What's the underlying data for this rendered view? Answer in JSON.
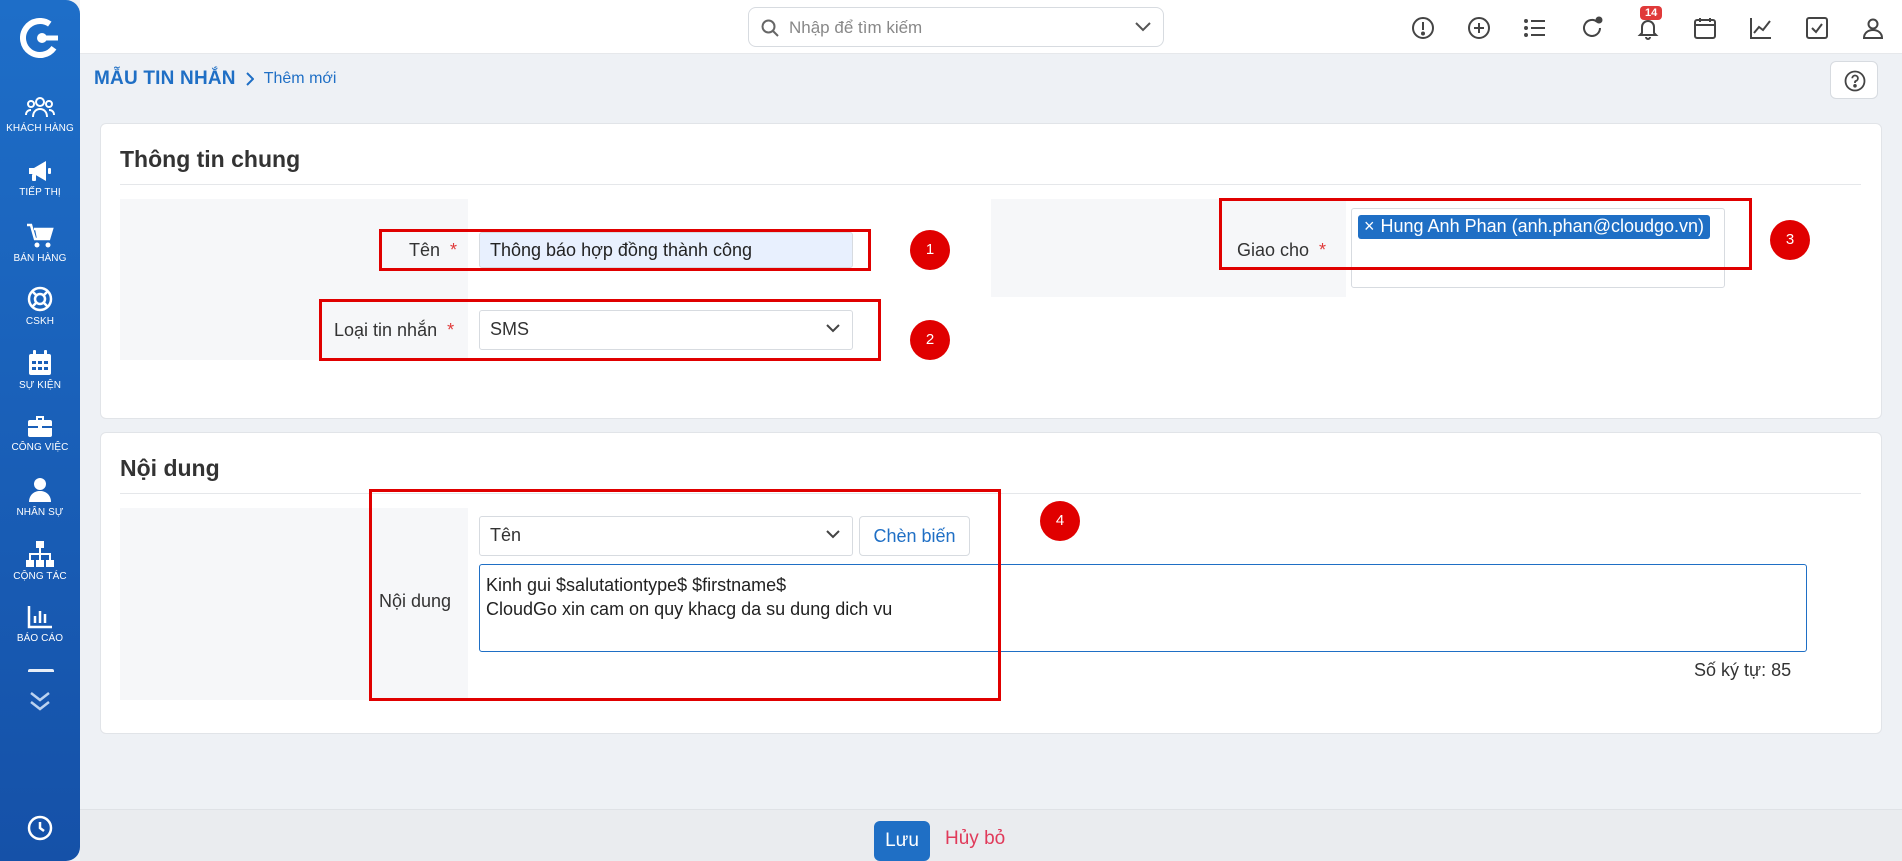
{
  "header": {
    "search": {
      "placeholder": "Nhập để tìm kiếm"
    },
    "notifications": {
      "badge_count": "14"
    },
    "icons": [
      "alert-icon",
      "plus-circle-icon",
      "list-icon",
      "refresh-icon",
      "bell-icon",
      "calendar-icon",
      "chart-icon",
      "checkbox-icon",
      "user-icon"
    ]
  },
  "sidebar": {
    "items": [
      {
        "label": "KHÁCH HÀNG",
        "icon": "users-icon"
      },
      {
        "label": "TIẾP THỊ",
        "icon": "megaphone-icon"
      },
      {
        "label": "BÁN HÀNG",
        "icon": "cart-icon"
      },
      {
        "label": "CSKH",
        "icon": "lifebuoy-icon"
      },
      {
        "label": "SỰ KIỆN",
        "icon": "calendar-icon"
      },
      {
        "label": "CÔNG VIỆC",
        "icon": "briefcase-icon"
      },
      {
        "label": "NHÂN SỰ",
        "icon": "person-icon"
      },
      {
        "label": "CỘNG TÁC",
        "icon": "org-chart-icon"
      },
      {
        "label": "BÁO CÁO",
        "icon": "bar-chart-icon"
      }
    ]
  },
  "breadcrumb": {
    "root": "MẪU TIN NHẮN",
    "current": "Thêm mới"
  },
  "section_general": {
    "title": "Thông tin chung",
    "name_label": "Tên",
    "name_value": "Thông báo hợp đồng thành công",
    "type_label": "Loại tin nhắn",
    "type_value": "SMS",
    "assign_label": "Giao cho",
    "assign_tag": "Hung Anh Phan (anh.phan@cloudgo.vn)",
    "required_mark": "*"
  },
  "section_content": {
    "title": "Nội dung",
    "content_label": "Nội dung",
    "variable_select": "Tên",
    "insert_button": "Chèn biến",
    "content_text": "Kinh gui $salutationtype$ $firstname$\nCloudGo xin cam on quy khacg da su dung dich vu",
    "char_count": "Số ký tự: 85"
  },
  "annotations": [
    "1",
    "2",
    "3",
    "4"
  ],
  "footer": {
    "save_label": "Lưu",
    "cancel_label": "Hủy bỏ"
  },
  "colors": {
    "primary": "#1f6fc5",
    "sidebar": "#1a5fb8",
    "annotation": "#e00000",
    "required": "#e03a3a"
  }
}
